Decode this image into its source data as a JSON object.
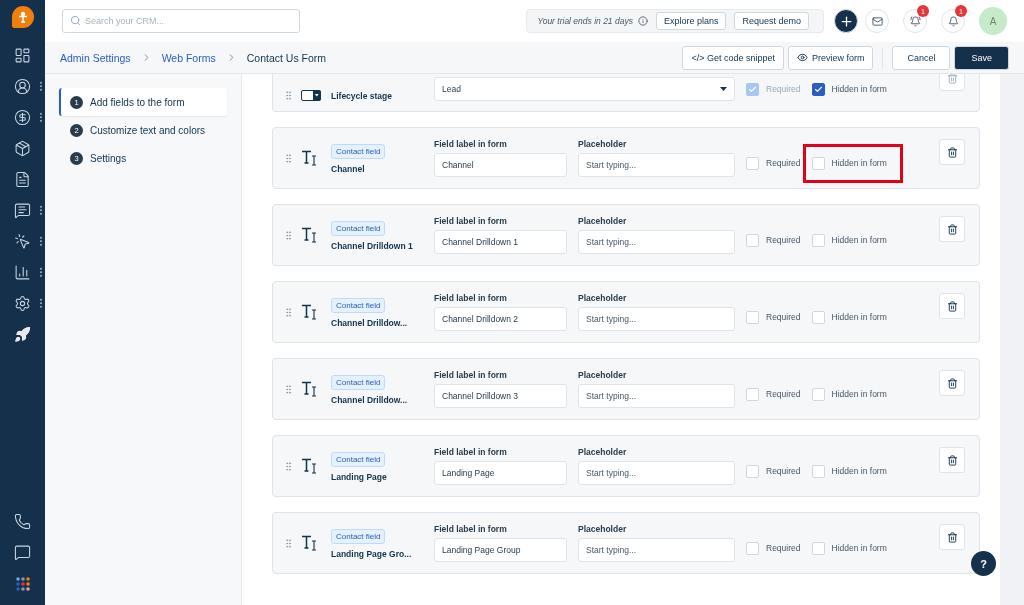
{
  "sidebar": {
    "items": [
      {
        "has_menu": false
      },
      {
        "has_menu": true
      },
      {
        "has_menu": true
      },
      {
        "has_menu": false
      },
      {
        "has_menu": false
      },
      {
        "has_menu": true
      },
      {
        "has_menu": true
      },
      {
        "has_menu": true
      },
      {
        "has_menu": true
      },
      {
        "has_menu": false
      }
    ]
  },
  "topbar": {
    "search": {
      "placeholder": "Search your CRM..."
    },
    "trial_text": "Your trial ends in 21 days",
    "trial_buttons": [
      "Explore plans",
      "Request demo"
    ],
    "notifications": [
      {
        "kind": "mail"
      },
      {
        "kind": "bot",
        "badge": "1"
      },
      {
        "kind": "bell",
        "badge": "1"
      }
    ],
    "avatar": "A"
  },
  "breadcrumb": {
    "links": [
      "Admin Settings",
      "Web Forms"
    ],
    "current": "Contact Us Form"
  },
  "actions": {
    "code_snippet": "</> Get code snippet",
    "preview": "Preview form",
    "cancel": "Cancel",
    "save": "Save"
  },
  "steps": [
    {
      "number": "1",
      "label": "Add fields to the form",
      "selected": true
    },
    {
      "number": "2",
      "label": "Customize text and colors",
      "selected": false
    },
    {
      "number": "3",
      "label": "Settings",
      "selected": false
    }
  ],
  "fields": [
    {
      "kind": "select",
      "name": "Lifecycle stage",
      "value": "Lead",
      "required_label": "Required",
      "required": true,
      "required_disabled": true,
      "hidden_label": "Hidden in form",
      "hidden": true,
      "highlighted": false
    },
    {
      "kind": "text",
      "badge": "Contact field",
      "name": "Channel",
      "label_heading": "Field label in form",
      "value": "Channel",
      "placeholder_heading": "Placeholder",
      "placeholder": "Start typing...",
      "required_label": "Required",
      "required": false,
      "required_disabled": false,
      "hidden_label": "Hidden in form",
      "hidden": false,
      "highlighted": true
    },
    {
      "kind": "text",
      "badge": "Contact field",
      "name": "Channel Drilldown 1",
      "label_heading": "Field label in form",
      "value": "Channel Drilldown 1",
      "placeholder_heading": "Placeholder",
      "placeholder": "Start typing...",
      "required_label": "Required",
      "required": false,
      "required_disabled": false,
      "hidden_label": "Hidden in form",
      "hidden": false,
      "highlighted": false
    },
    {
      "kind": "text",
      "badge": "Contact field",
      "name": "Channel Drilldow...",
      "label_heading": "Field label in form",
      "value": "Channel Drilldown 2",
      "placeholder_heading": "Placeholder",
      "placeholder": "Start typing...",
      "required_label": "Required",
      "required": false,
      "required_disabled": false,
      "hidden_label": "Hidden in form",
      "hidden": false,
      "highlighted": false
    },
    {
      "kind": "text",
      "badge": "Contact field",
      "name": "Channel Drilldow...",
      "label_heading": "Field label in form",
      "value": "Channel Drilldown 3",
      "placeholder_heading": "Placeholder",
      "placeholder": "Start typing...",
      "required_label": "Required",
      "required": false,
      "required_disabled": false,
      "hidden_label": "Hidden in form",
      "hidden": false,
      "highlighted": false
    },
    {
      "kind": "text",
      "badge": "Contact field",
      "name": "Landing Page",
      "label_heading": "Field label in form",
      "value": "Landing Page",
      "placeholder_heading": "Placeholder",
      "placeholder": "Start typing...",
      "required_label": "Required",
      "required": false,
      "required_disabled": false,
      "hidden_label": "Hidden in form",
      "hidden": false,
      "highlighted": false
    },
    {
      "kind": "text",
      "badge": "Contact field",
      "name": "Landing Page Gro...",
      "label_heading": "Field label in form",
      "value": "Landing Page Group",
      "placeholder_heading": "Placeholder",
      "placeholder": "Start typing...",
      "required_label": "Required",
      "required": false,
      "required_disabled": false,
      "hidden_label": "Hidden in form",
      "hidden": false,
      "highlighted": false
    }
  ],
  "help_button": "?"
}
